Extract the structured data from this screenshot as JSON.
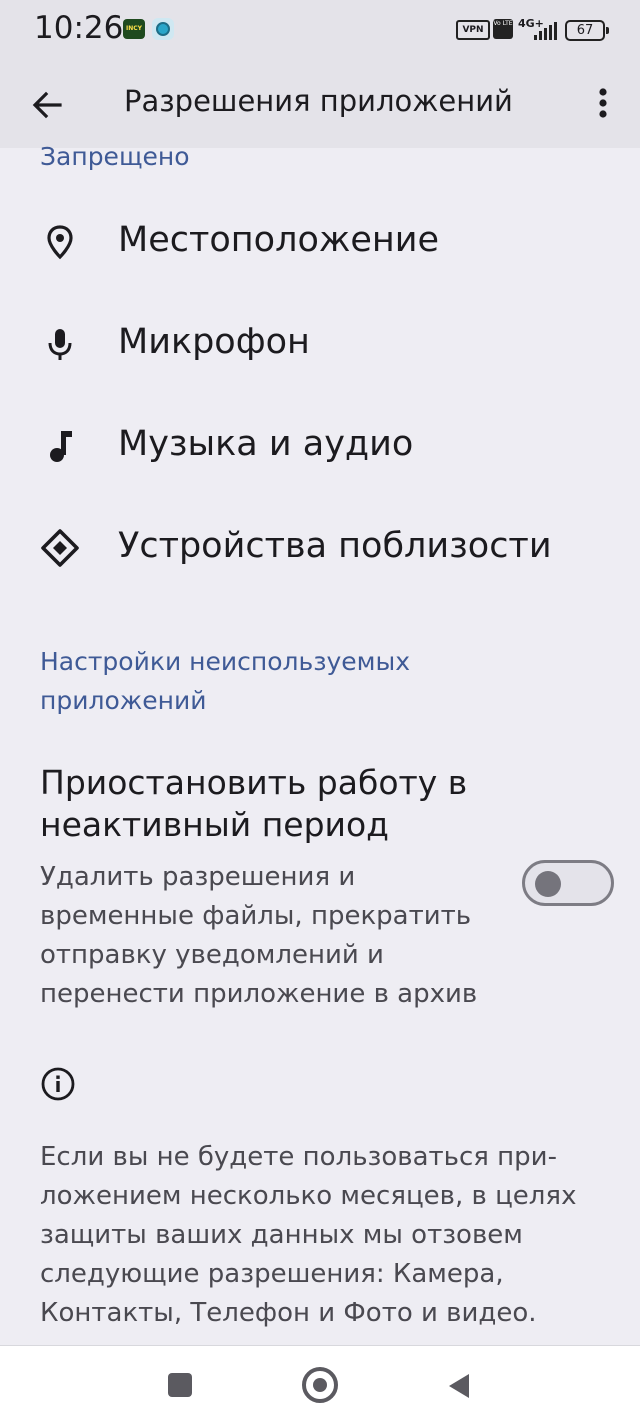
{
  "status_bar": {
    "time": "10:26",
    "app_icon_text": "INCY",
    "vpn_label": "VPN",
    "volte_label": "Vo LTE",
    "network_label": "4G+",
    "battery_level": "67"
  },
  "app_bar": {
    "title": "Разрешения приложений",
    "back_icon": "arrow-back-icon",
    "menu_icon": "more-vert-icon"
  },
  "denied_section": {
    "header": "Запрещено",
    "items": [
      {
        "label": "Местоположение",
        "icon": "location-pin-icon"
      },
      {
        "label": "Микрофон",
        "icon": "microphone-icon"
      },
      {
        "label": "Музыка и аудио",
        "icon": "music-note-icon"
      },
      {
        "label": "Устройства поблизости",
        "icon": "nearby-devices-icon"
      }
    ]
  },
  "unused_section": {
    "header": "Настройки неиспользуемых приложений",
    "pause_title": "Приостановить работу в неактивный период",
    "pause_summary": "Удалить разрешения и временные файлы, прекратить отправку уведомлений и перенести приложение в архив",
    "toggle_on": false,
    "info_text": "Если вы не будете пользоваться при­ложением несколько месяцев, в целях защиты ваших данных мы отзовем следующие разрешения: Камера, Контакты, Телефон и Фото и видео."
  },
  "nav_bar": {
    "recents_icon": "square-recents-icon",
    "home_icon": "circle-home-icon",
    "back_icon": "triangle-back-icon"
  }
}
